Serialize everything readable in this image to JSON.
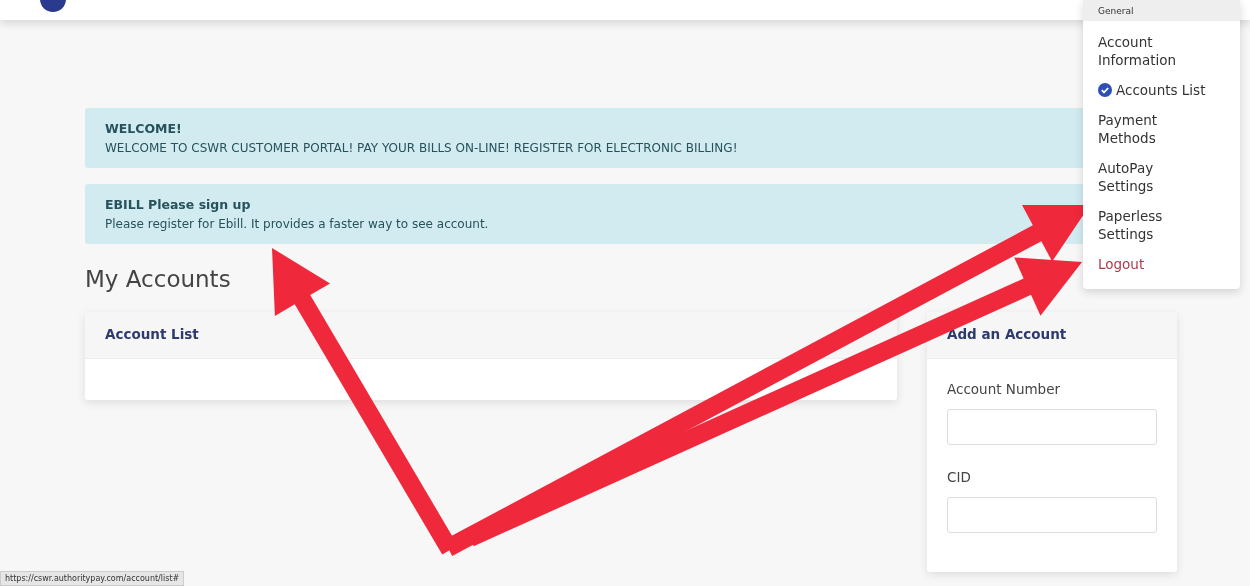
{
  "alerts": [
    {
      "title": "WELCOME!",
      "text": "WELCOME TO CSWR CUSTOMER PORTAL! PAY YOUR BILLS ON-LINE! REGISTER FOR ELECTRONIC BILLING!"
    },
    {
      "title": "EBILL Please sign up",
      "text": "Please register for Ebill. It provides a faster way to see account."
    }
  ],
  "heading": "My Accounts",
  "account_list": {
    "title": "Account List"
  },
  "add_account": {
    "title": "Add an Account",
    "fields": [
      {
        "label": "Account Number"
      },
      {
        "label": "CID"
      }
    ]
  },
  "menu": {
    "section": "General",
    "items": [
      {
        "label": "Account Information",
        "kind": "link",
        "selected": false
      },
      {
        "label": "Accounts List",
        "kind": "link",
        "selected": true
      },
      {
        "label": "Payment Methods",
        "kind": "link",
        "selected": false
      },
      {
        "label": "AutoPay Settings",
        "kind": "link",
        "selected": false
      },
      {
        "label": "Paperless Settings",
        "kind": "link",
        "selected": false
      },
      {
        "label": "Logout",
        "kind": "logout",
        "selected": false
      }
    ]
  },
  "status_url": "https://cswr.authoritypay.com/account/list#"
}
